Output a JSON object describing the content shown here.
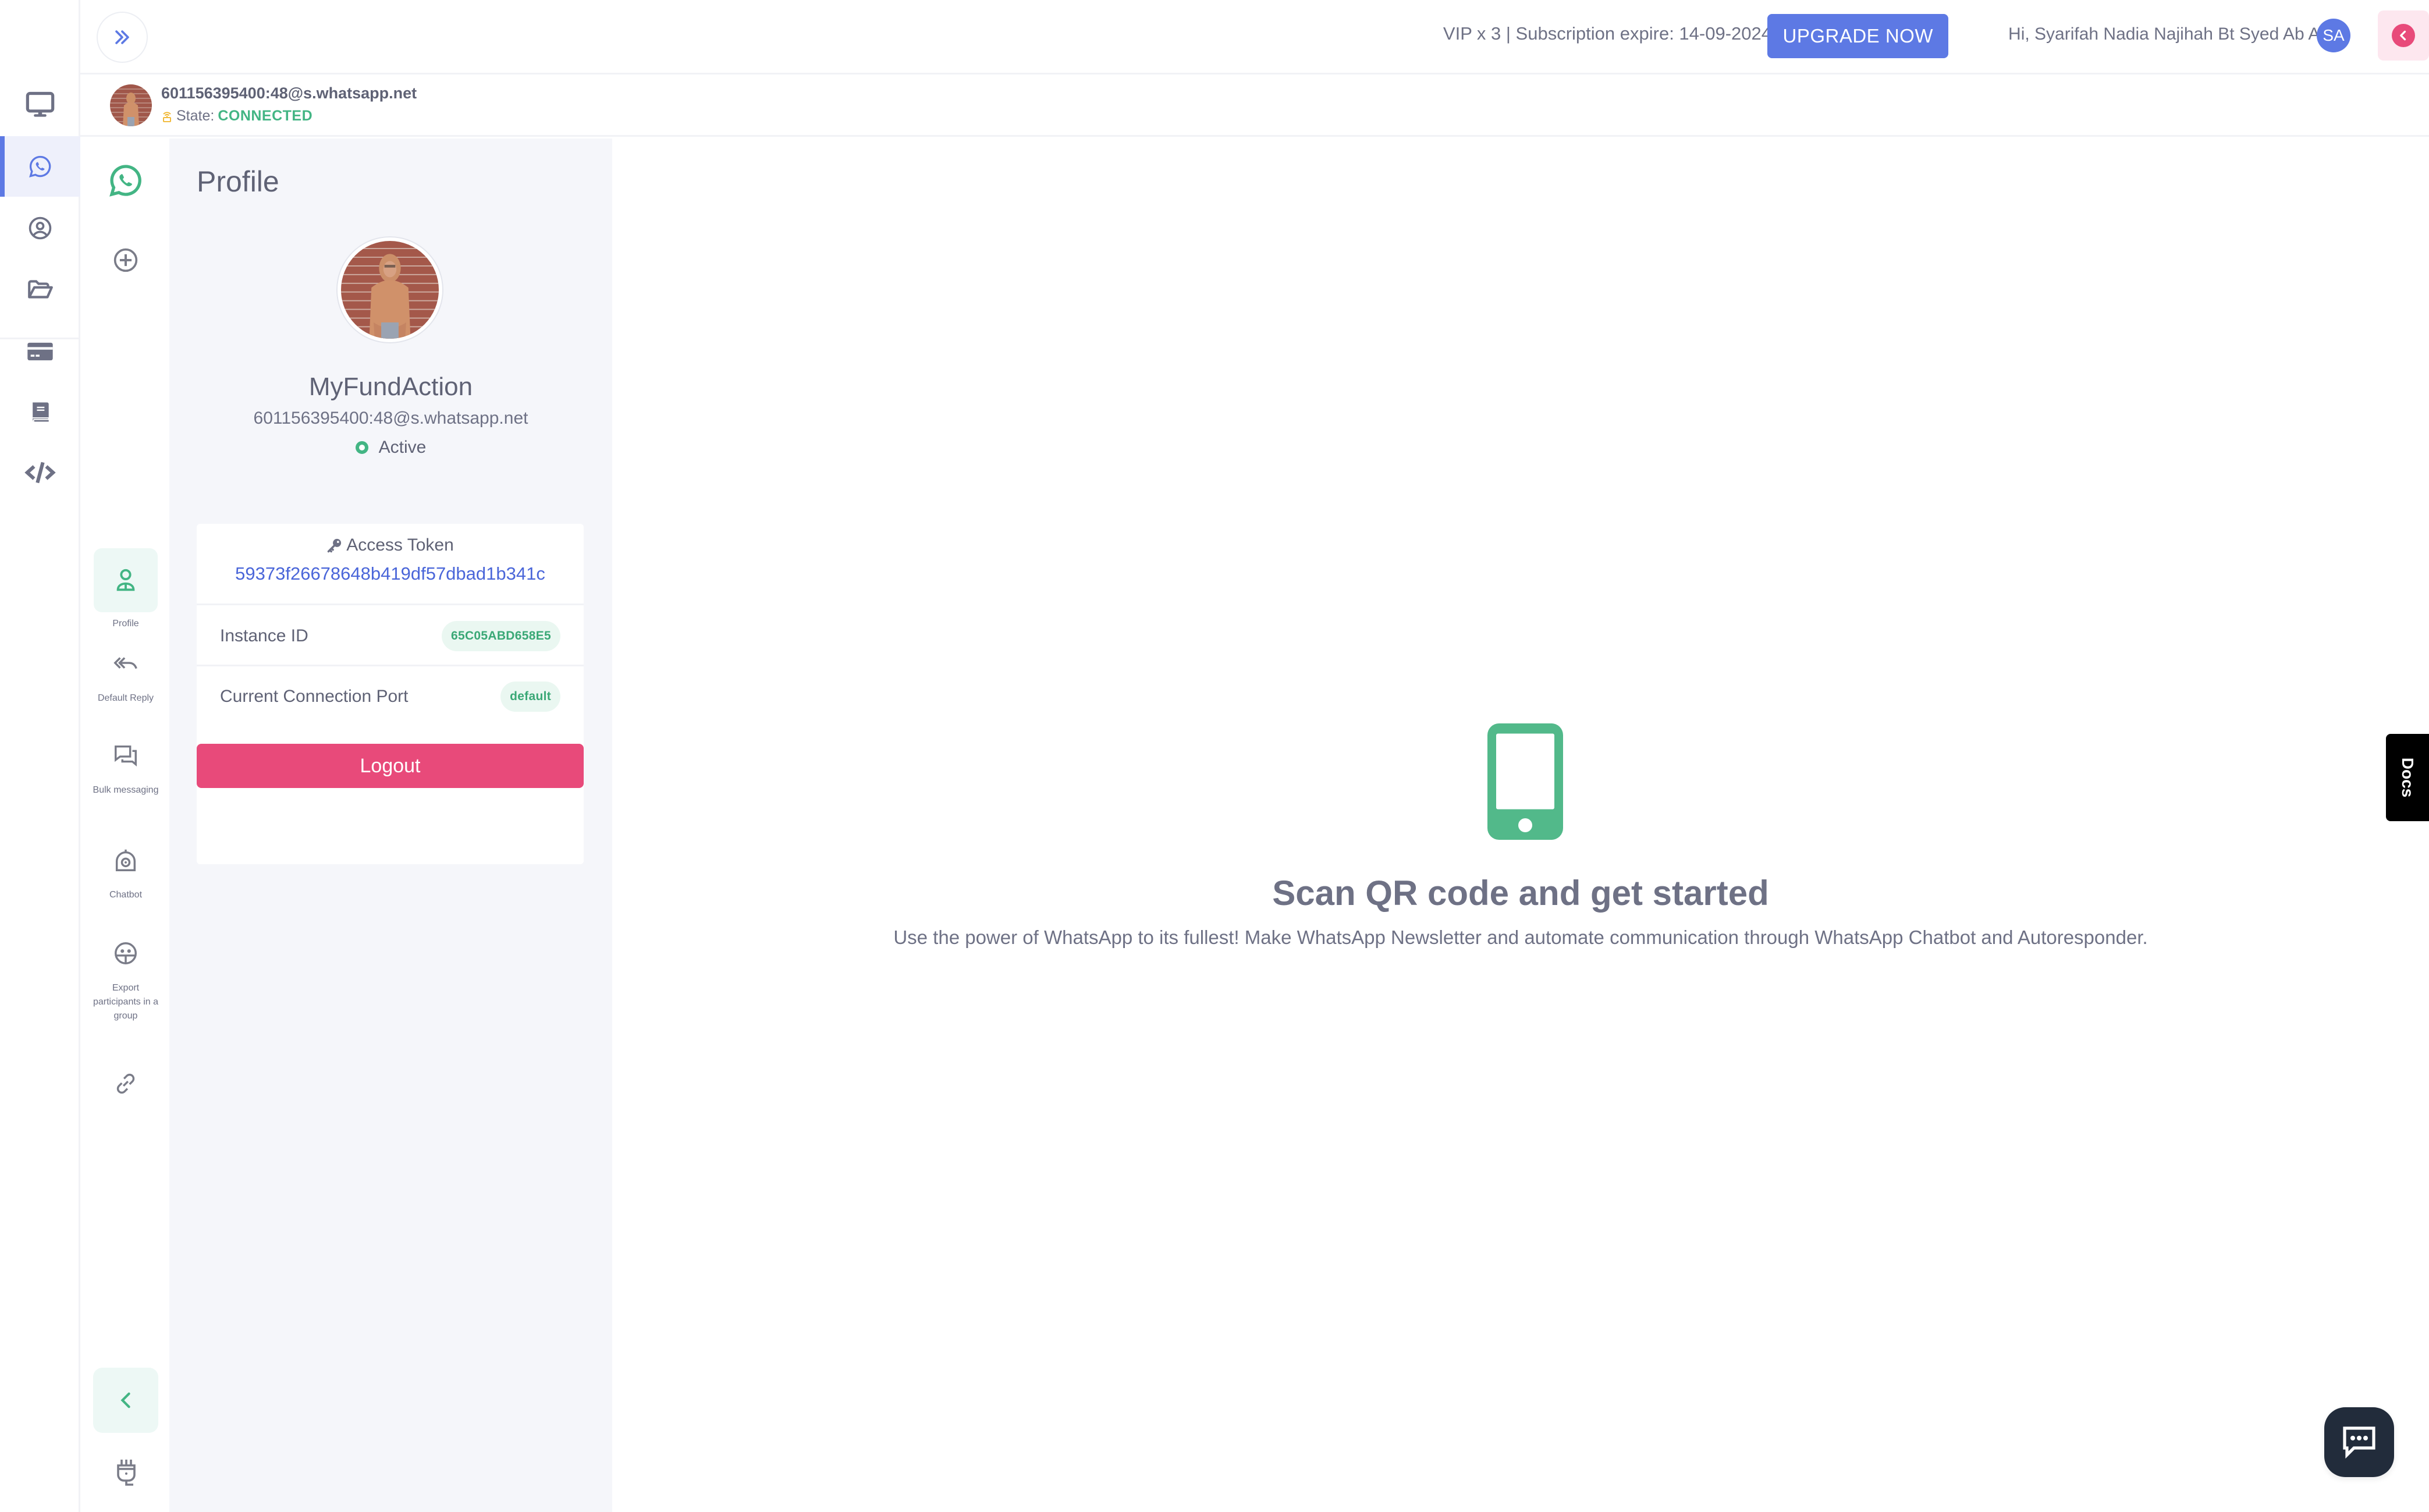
{
  "rail": {
    "items": [
      {
        "icon": "monitor-icon",
        "label": "Dashboard",
        "active": false
      },
      {
        "icon": "whatsapp-icon",
        "label": "WhatsApp",
        "active": true
      },
      {
        "icon": "user-circle-icon",
        "label": "Contacts",
        "active": false
      },
      {
        "icon": "folder-open-icon",
        "label": "Files",
        "active": false
      },
      {
        "icon": "credit-card-icon",
        "label": "Billing",
        "active": false
      },
      {
        "icon": "book-icon",
        "label": "Documentation",
        "active": false
      },
      {
        "icon": "code-icon",
        "label": "API",
        "active": false
      }
    ]
  },
  "header": {
    "expand_icon": "chevrons-right-icon",
    "subscription_text": "VIP x 3 | Subscription expire: 14-09-2024",
    "upgrade_label": "UPGRADE NOW",
    "greeting": "Hi, Syarifah Nadia Najihah Bt Syed Ab Aziz",
    "user_initials": "SA",
    "back_icon": "chevron-left-circle-icon"
  },
  "connection": {
    "jid": "601156395400:48@s.whatsapp.net",
    "state_label": "State:",
    "state_value": "CONNECTED"
  },
  "subrail": {
    "top_icons": [
      "whatsapp-icon",
      "add-circle-icon"
    ],
    "features": [
      {
        "label": "Profile",
        "icon": "profile-icon",
        "active": true
      },
      {
        "label": "Default Reply",
        "icon": "reply-all-icon",
        "active": false
      },
      {
        "label": "Bulk messaging",
        "icon": "chat-bubbles-icon",
        "active": false
      },
      {
        "label": "Chatbot",
        "icon": "robot-icon",
        "active": false
      },
      {
        "label": "Export participants in a group",
        "icon": "group-export-icon",
        "active": false
      },
      {
        "label": "",
        "icon": "link-icon",
        "active": false
      }
    ],
    "collapse_icon": "chevron-left-icon",
    "plug_icon": "plug-icon"
  },
  "profile": {
    "title": "Profile",
    "name": "MyFundAction",
    "jid": "601156395400:48@s.whatsapp.net",
    "status": "Active",
    "access_token_label": "Access Token",
    "access_token": "59373f26678648b419df57dbad1b341c",
    "instance_id_label": "Instance ID",
    "instance_id": "65C05ABD658E5",
    "port_label": "Current Connection Port",
    "port_value": "default",
    "logout_label": "Logout"
  },
  "main": {
    "title": "Scan QR code and get started",
    "subtitle": "Use the power of WhatsApp to its fullest! Make WhatsApp Newsletter and automate communication through WhatsApp Chatbot and Autoresponder."
  },
  "floating": {
    "docs_label": "Docs",
    "chat_icon": "chat-support-icon"
  },
  "colors": {
    "primary": "#5d79e4",
    "success": "#43b584",
    "danger": "#e84a7a",
    "text": "#6e7185",
    "panel_bg": "#f5f6fa"
  }
}
